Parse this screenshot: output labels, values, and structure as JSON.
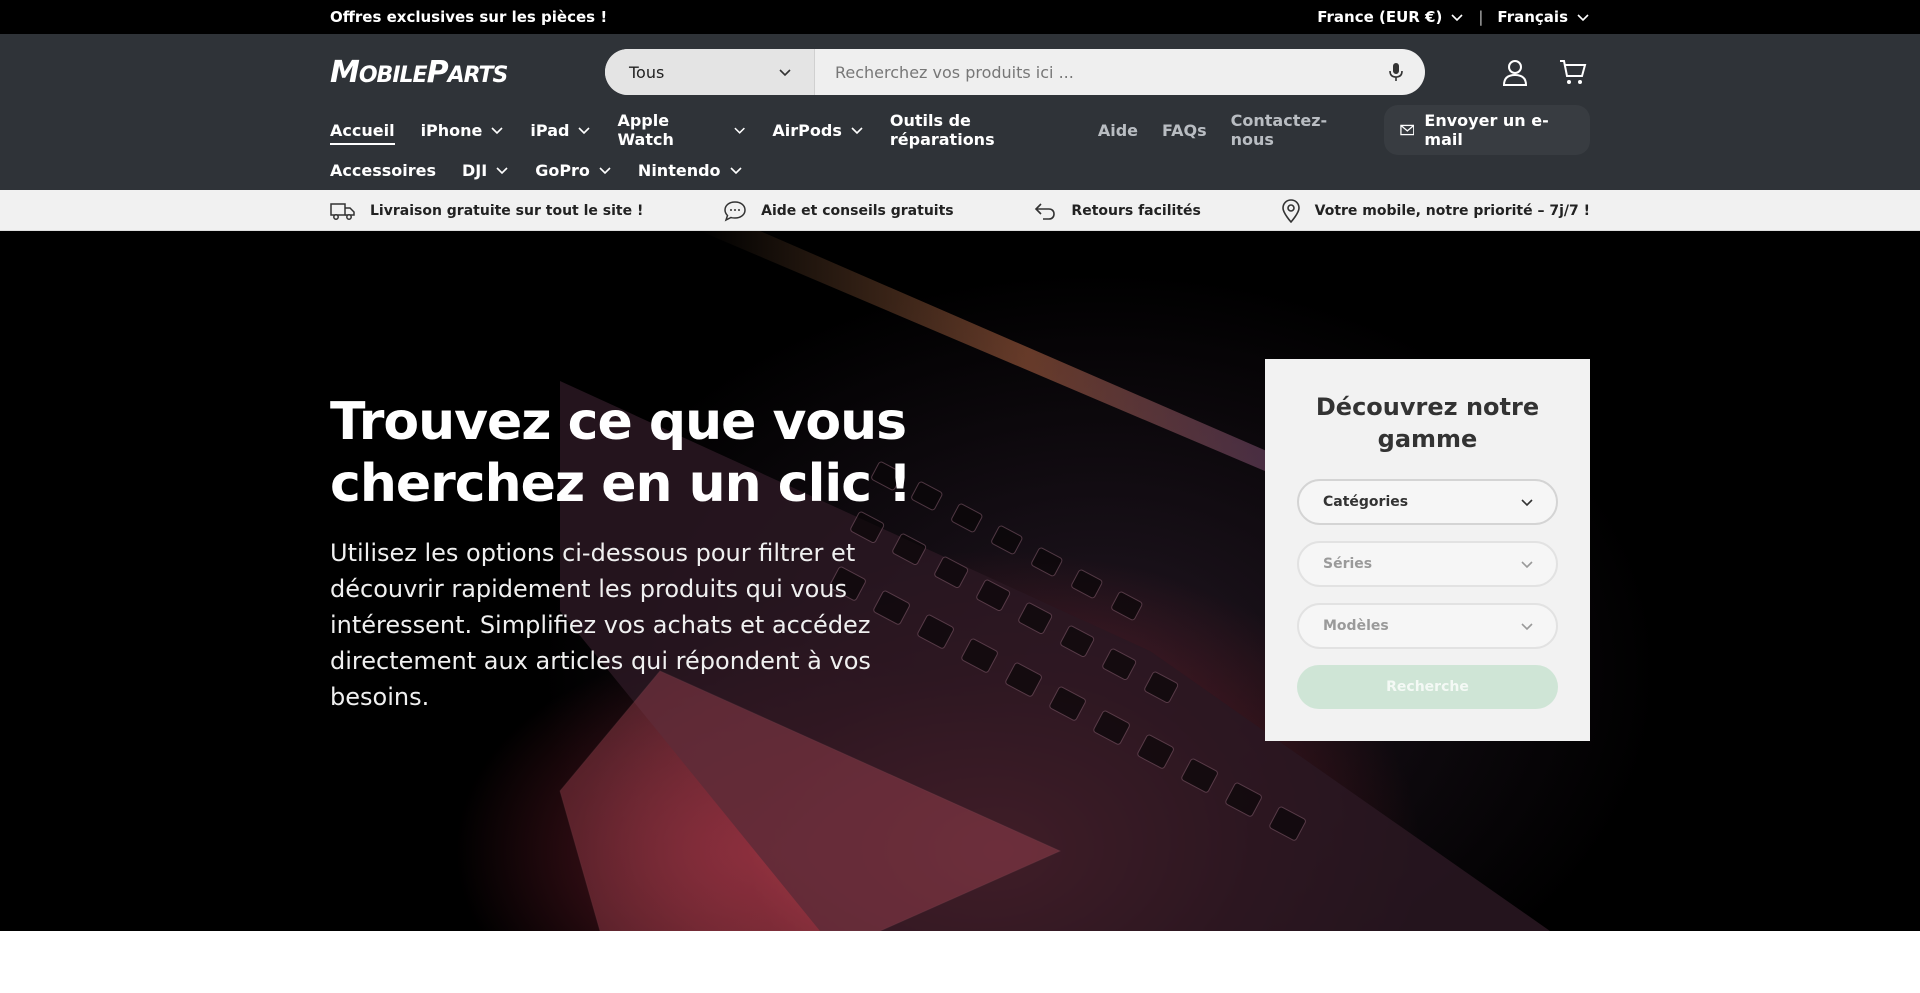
{
  "topbar": {
    "promo": "Offres exclusives sur les pièces !",
    "country": "France (EUR €)",
    "separator": "|",
    "language": "Français"
  },
  "header": {
    "logo": {
      "part1_big": "M",
      "part1_small": "OBILE",
      "part2_big": "P",
      "part2_small": "ARTS"
    },
    "search": {
      "category": "Tous",
      "placeholder": "Recherchez vos produits ici ..."
    },
    "icons": [
      "microphone-icon",
      "account-icon",
      "cart-icon"
    ]
  },
  "nav": {
    "primary": [
      {
        "label": "Accueil",
        "dropdown": false,
        "active": true
      },
      {
        "label": "iPhone",
        "dropdown": true
      },
      {
        "label": "iPad",
        "dropdown": true
      },
      {
        "label": "Apple Watch",
        "dropdown": true
      },
      {
        "label": "AirPods",
        "dropdown": true
      },
      {
        "label": "Outils de réparations",
        "dropdown": false
      }
    ],
    "secondary": [
      {
        "label": "Accessoires",
        "dropdown": false
      },
      {
        "label": "DJI",
        "dropdown": true
      },
      {
        "label": "GoPro",
        "dropdown": true
      },
      {
        "label": "Nintendo",
        "dropdown": true
      }
    ],
    "links": [
      "Aide",
      "FAQs",
      "Contactez-nous"
    ],
    "email_button": "Envoyer un e-mail"
  },
  "usp": [
    {
      "icon": "truck-icon",
      "text": "Livraison gratuite sur tout le site !"
    },
    {
      "icon": "chat-icon",
      "text": "Aide et conseils gratuits"
    },
    {
      "icon": "return-arrow-icon",
      "text": "Retours facilités"
    },
    {
      "icon": "location-pin-icon",
      "text": "Votre mobile, notre priorité – 7j/7 !"
    }
  ],
  "hero": {
    "title_line1": "Trouvez ce que vous",
    "title_line2": "cherchez en un clic !",
    "description": "Utilisez les options ci-dessous pour filtrer et découvrir rapidement les produits qui vous intéressent. Simplifiez vos achats et accédez directement aux articles qui répondent à vos besoins."
  },
  "finder": {
    "title": "Découvrez notre gamme",
    "categories": "Catégories",
    "series": "Séries",
    "models": "Modèles",
    "search_button": "Recherche"
  },
  "colors": {
    "header_bg": "#2f3338",
    "topbar_bg": "#000000",
    "search_button_disabled": "#cfe5d6"
  }
}
